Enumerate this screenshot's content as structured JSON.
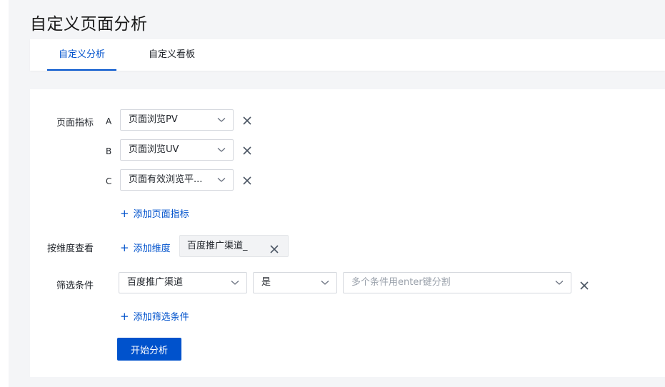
{
  "page": {
    "title": "自定义页面分析"
  },
  "tabs": [
    {
      "label": "自定义分析",
      "active": true
    },
    {
      "label": "自定义看板",
      "active": false
    }
  ],
  "metrics": {
    "label": "页面指标",
    "items": [
      {
        "letter": "A",
        "value": "页面浏览PV"
      },
      {
        "letter": "B",
        "value": "页面浏览UV"
      },
      {
        "letter": "C",
        "value": "页面有效浏览平..."
      }
    ],
    "add_label": "添加页面指标"
  },
  "dimension": {
    "label": "按维度查看",
    "add_label": "添加维度",
    "tag": "百度推广渠道_"
  },
  "filter": {
    "label": "筛选条件",
    "field": "百度推广渠道",
    "operator": "是",
    "value_placeholder": "多个条件用enter键分割",
    "add_label": "添加筛选条件"
  },
  "actions": {
    "start_label": "开始分析"
  },
  "colors": {
    "accent": "#0052cc",
    "background": "#f4f5f7",
    "card": "#ffffff"
  },
  "icons": {
    "close": "close-icon",
    "chevron": "chevron-down-icon",
    "plus": "plus-icon"
  }
}
